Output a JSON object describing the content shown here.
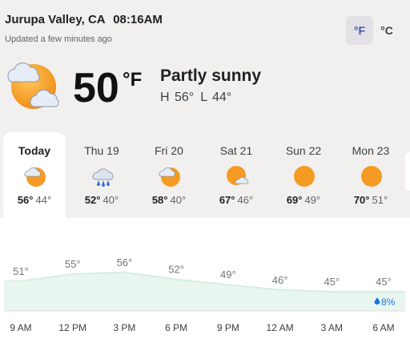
{
  "header": {
    "location": "Jurupa Valley, CA",
    "time": "08:16AM",
    "updated": "Updated a few minutes ago"
  },
  "units": {
    "fahrenheit": "°F",
    "celsius": "°C",
    "selected": "°F"
  },
  "current": {
    "icon": "partly-sunny-icon",
    "temp": "50",
    "unit": "°F",
    "condition": "Partly sunny",
    "high": "H 56°",
    "low": "L 44°"
  },
  "forecast": [
    {
      "day": "Today",
      "icon": "partly-sunny-icon",
      "high": "56°",
      "low": "44°",
      "selected": true
    },
    {
      "day": "Thu 19",
      "icon": "rain-cloud-icon",
      "high": "52°",
      "low": "40°"
    },
    {
      "day": "Fri 20",
      "icon": "partly-sunny-icon",
      "high": "58°",
      "low": "40°"
    },
    {
      "day": "Sat 21",
      "icon": "mostly-sunny-icon",
      "high": "67°",
      "low": "46°"
    },
    {
      "day": "Sun 22",
      "icon": "sunny-icon",
      "high": "69°",
      "low": "49°"
    },
    {
      "day": "Mon 23",
      "icon": "sunny-icon",
      "high": "70°",
      "low": "51°"
    }
  ],
  "colors": {
    "panel_bg": "#f2f0ef",
    "sun": "#f59a23",
    "cloud": "#e3ebf5",
    "chart_fill": "#e8f6ef",
    "chart_line": "#d7eee2",
    "precip_icon": "#1a73e8"
  },
  "chart_data": {
    "type": "area",
    "x": [
      "9 AM",
      "12 PM",
      "3 PM",
      "6 PM",
      "9 PM",
      "12 AM",
      "3 AM",
      "6 AM"
    ],
    "values": [
      51,
      55,
      56,
      52,
      49,
      46,
      45,
      45
    ],
    "value_labels": [
      "51°",
      "55°",
      "56°",
      "52°",
      "49°",
      "46°",
      "45°",
      "45°"
    ],
    "precip_label": "8%",
    "grid": false
  }
}
